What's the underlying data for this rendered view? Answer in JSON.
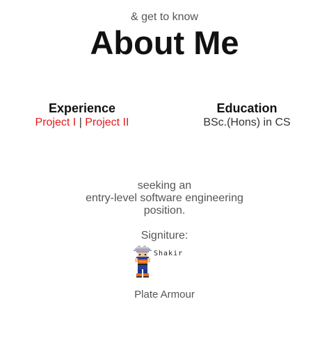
{
  "header": {
    "subtitle": "& get to know",
    "title": "About Me"
  },
  "experience": {
    "heading": "Experience",
    "links": [
      "Project I",
      "Project II"
    ],
    "separator": "|"
  },
  "education": {
    "heading": "Education",
    "degree": "BSc.(Hons) in CS"
  },
  "seeking": {
    "lines": [
      "seeking an",
      "entry-level software engineering",
      "position."
    ]
  },
  "signature": {
    "label": "Signiture:",
    "name": "Shakir",
    "sprite_icon": "pixel-character-icon"
  },
  "caption": "Plate Armour",
  "colors": {
    "link": "#e01b1b",
    "heading": "#111111",
    "text": "#555555"
  }
}
